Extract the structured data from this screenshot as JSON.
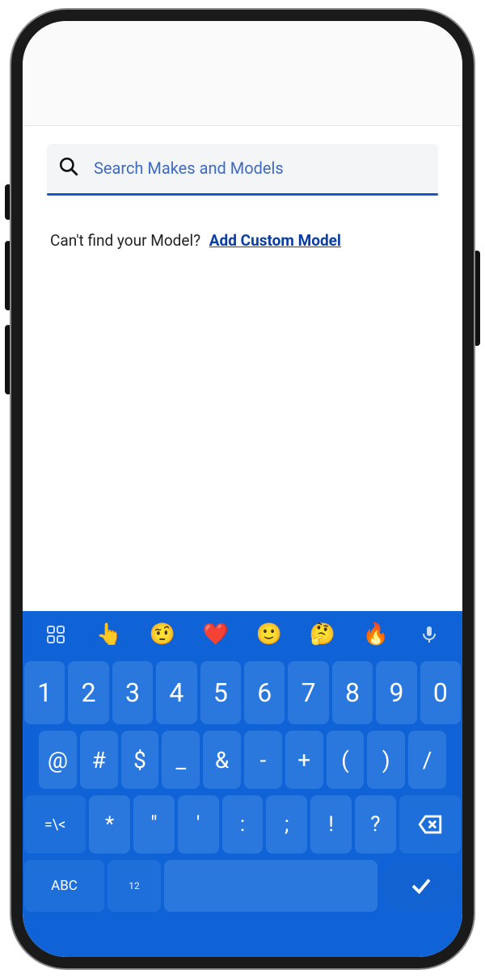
{
  "search": {
    "placeholder": "Search Makes and Models"
  },
  "hint": {
    "text": "Can't find your Model?",
    "link": "Add Custom Model"
  },
  "emoji": {
    "e1": "👆",
    "e2": "🤨",
    "e3": "❤️",
    "e4": "🙂",
    "e5": "🤔",
    "e6": "🔥"
  },
  "keys": {
    "row1": [
      "1",
      "2",
      "3",
      "4",
      "5",
      "6",
      "7",
      "8",
      "9",
      "0"
    ],
    "row2": [
      "@",
      "#",
      "$",
      "_",
      "&",
      "-",
      "+",
      "(",
      ")",
      "/"
    ],
    "row3_mode": "=\\<",
    "row3": [
      "*",
      "\"",
      "'",
      ":",
      ";",
      "!",
      "?"
    ],
    "row4_abc": "ABC",
    "row4_num": "12"
  },
  "colors": {
    "keyboard_bg": "#0f63d6",
    "key_bg": "#2a77dd",
    "accent": "#1559c8"
  }
}
